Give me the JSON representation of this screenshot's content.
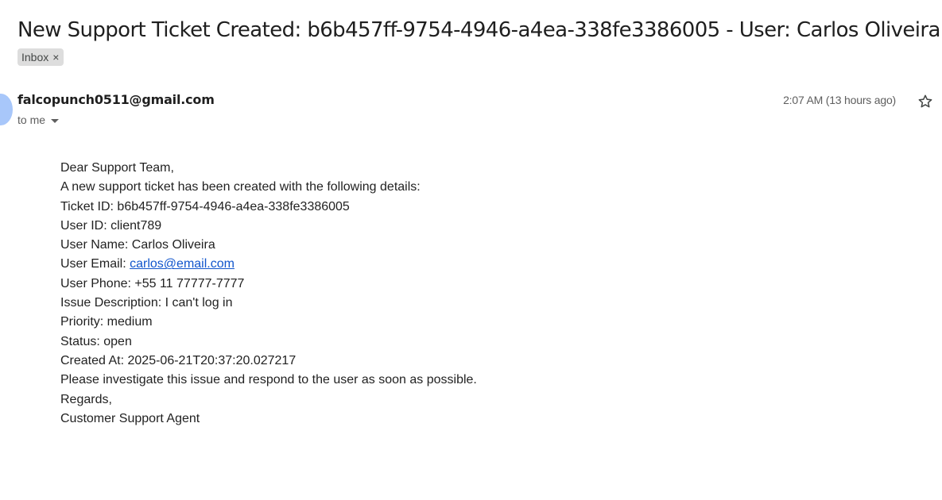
{
  "subject": "New Support Ticket Created: b6b457ff-9754-4946-a4ea-338fe3386005 - User: Carlos Oliveira",
  "label": {
    "name": "Inbox",
    "remove_glyph": "×"
  },
  "sender": "falcopunch0511@gmail.com",
  "recipient": "to me",
  "timestamp": "2:07 AM (13 hours ago)",
  "icons": {
    "star": "star-icon",
    "recipient_toggle": "chevron-down-icon"
  },
  "colors": {
    "link": "#1155cc",
    "chip_bg": "#dddddd",
    "avatar": "#a8c7fa"
  },
  "body": {
    "greeting": "Dear Support Team,",
    "intro": "A new support ticket has been created with the following details:",
    "ticket_id": "Ticket ID: b6b457ff-9754-4946-a4ea-338fe3386005",
    "user_id": "User ID: client789",
    "user_name": "User Name: Carlos Oliveira",
    "user_email_label": "User Email: ",
    "user_email": "carlos@email.com",
    "user_phone": "User Phone: +55 11 77777-7777",
    "issue": "Issue Description: I can't log in",
    "priority": "Priority: medium",
    "status": "Status: open",
    "created_at": "Created At: 2025-06-21T20:37:20.027217",
    "request": "Please investigate this issue and respond to the user as soon as possible.",
    "regards": "Regards,",
    "signature": "Customer Support Agent"
  }
}
